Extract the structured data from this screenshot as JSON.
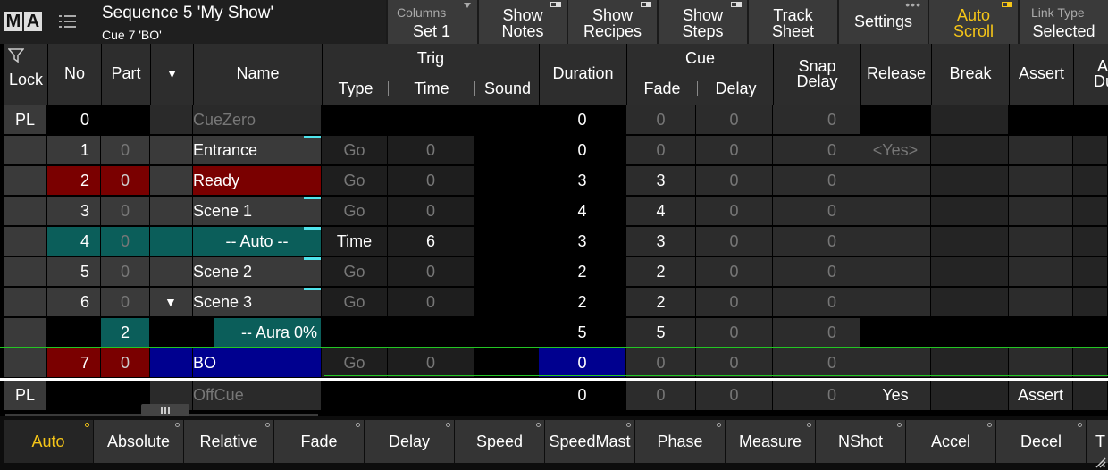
{
  "header": {
    "logo": [
      "M",
      "A"
    ],
    "title": "Sequence 5 'My Show'",
    "subtitle": "Cue 7 'BO'",
    "columns": {
      "label": "Columns",
      "value": "Set 1"
    },
    "show_notes": [
      "Show",
      "Notes"
    ],
    "show_recipes": [
      "Show",
      "Recipes"
    ],
    "show_steps": [
      "Show",
      "Steps"
    ],
    "track_sheet": [
      "Track",
      "Sheet"
    ],
    "settings": "Settings",
    "auto_scroll": [
      "Auto",
      "Scroll"
    ],
    "link_type": {
      "label": "Link Type",
      "value": "Selected"
    }
  },
  "columns": {
    "lock": "Lock",
    "no": "No",
    "part": "Part",
    "name": "Name",
    "trig": "Trig",
    "type": "Type",
    "time": "Time",
    "sound": "Sound",
    "duration": "Duration",
    "cue": "Cue",
    "fade": "Fade",
    "delay": "Delay",
    "snap_delay": [
      "Snap",
      "Delay"
    ],
    "release": "Release",
    "break": "Break",
    "assert": "Assert",
    "dup": [
      "A",
      "Dup"
    ]
  },
  "rows": [
    {
      "lock": "PL",
      "no": "0",
      "part": "",
      "name": "CueZero",
      "type": "",
      "time": "",
      "duration": "0",
      "fade": "0",
      "delay": "0",
      "snap": "0",
      "release": "",
      "assert": ""
    },
    {
      "lock": "",
      "no": "1",
      "part": "0",
      "name": "Entrance",
      "type": "Go",
      "time": "0",
      "duration": "0",
      "fade": "0",
      "delay": "0",
      "snap": "0",
      "release": "<Yes>",
      "assert": ""
    },
    {
      "lock": "",
      "no": "2",
      "part": "0",
      "name": "Ready",
      "type": "Go",
      "time": "0",
      "duration": "3",
      "fade": "3",
      "delay": "0",
      "snap": "0",
      "release": "",
      "assert": ""
    },
    {
      "lock": "",
      "no": "3",
      "part": "0",
      "name": "Scene  1",
      "type": "Go",
      "time": "0",
      "duration": "4",
      "fade": "4",
      "delay": "0",
      "snap": "0",
      "release": "",
      "assert": ""
    },
    {
      "lock": "",
      "no": "4",
      "part": "0",
      "name": "-- Auto --",
      "type": "Time",
      "time": "6",
      "duration": "3",
      "fade": "3",
      "delay": "0",
      "snap": "0",
      "release": "",
      "assert": ""
    },
    {
      "lock": "",
      "no": "5",
      "part": "0",
      "name": "Scene  2",
      "type": "Go",
      "time": "0",
      "duration": "2",
      "fade": "2",
      "delay": "0",
      "snap": "0",
      "release": "",
      "assert": ""
    },
    {
      "lock": "",
      "no": "6",
      "part": "0",
      "name": "Scene  3",
      "type": "Go",
      "time": "0",
      "duration": "2",
      "fade": "2",
      "delay": "0",
      "snap": "0",
      "release": "",
      "assert": ""
    },
    {
      "lock": "",
      "no": "",
      "part": "2",
      "name": "-- Aura  0%",
      "type": "",
      "time": "",
      "duration": "5",
      "fade": "5",
      "delay": "0",
      "snap": "0",
      "release": "",
      "assert": ""
    },
    {
      "lock": "",
      "no": "7",
      "part": "0",
      "name": "BO",
      "type": "Go",
      "time": "0",
      "duration": "0",
      "fade": "0",
      "delay": "0",
      "snap": "0",
      "release": "",
      "assert": ""
    },
    {
      "lock": "PL",
      "no": "",
      "part": "",
      "name": "OffCue",
      "type": "",
      "time": "",
      "duration": "0",
      "fade": "0",
      "delay": "0",
      "snap": "0",
      "release": "Yes",
      "assert": "Assert"
    }
  ],
  "toolbar": [
    "Auto",
    "Absolute",
    "Relative",
    "Fade",
    "Delay",
    "Speed",
    "SpeedMast",
    "Phase",
    "Measure",
    "NShot",
    "Accel",
    "Decel",
    "T"
  ],
  "colors": {
    "accent": "#f5c518",
    "selected_row": "#7a0000",
    "auto_row": "#0b5e5a",
    "current_cue": "#00008f",
    "marker": "#4fe4ec",
    "current_line": "#23c623"
  }
}
